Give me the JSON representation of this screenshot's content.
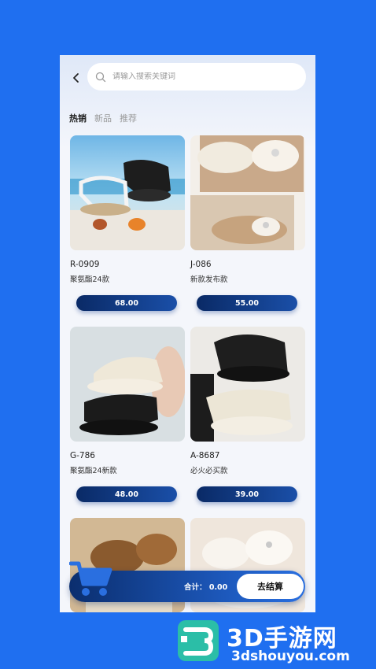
{
  "search": {
    "placeholder": "请输入搜索关键词"
  },
  "tabs": [
    {
      "label": "热销",
      "active": true
    },
    {
      "label": "新品",
      "active": false
    },
    {
      "label": "推荐",
      "active": false
    }
  ],
  "products": [
    {
      "code": "R-0909",
      "name": "聚氨酯24款",
      "price": "68.00"
    },
    {
      "code": "J-086",
      "name": "新款发布款",
      "price": "55.00"
    },
    {
      "code": "G-786",
      "name": "聚氨酯24新款",
      "price": "48.00"
    },
    {
      "code": "A-8687",
      "name": "必火必买款",
      "price": "39.00"
    }
  ],
  "cart": {
    "total_label": "合计：",
    "total_value": "0.00",
    "checkout_label": "去结算"
  },
  "brand": {
    "title": "3D手游网",
    "url": "3dshouyou.com"
  },
  "colors": {
    "background": "#1f6ff0",
    "accent_dark": "#0b2e6e",
    "accent": "#1e5bc0"
  }
}
